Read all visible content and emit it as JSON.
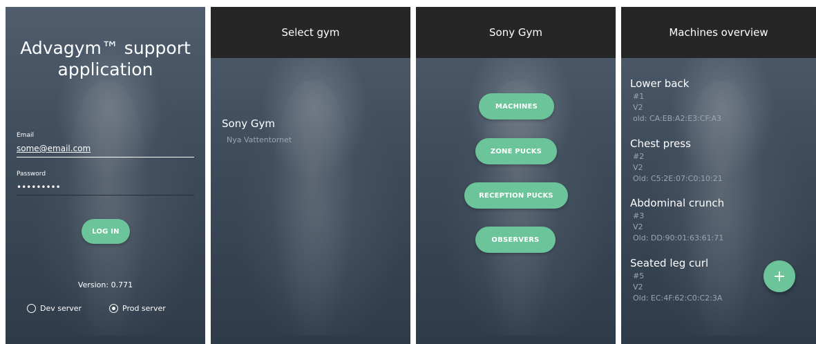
{
  "login": {
    "app_title": "Advagym™ support application",
    "email_label": "Email",
    "email_value": "some@email.com",
    "password_label": "Password",
    "password_value": "•••••••••",
    "login_button": "LOG IN",
    "version": "Version: 0.771",
    "server_options": [
      {
        "label": "Dev server",
        "selected": false
      },
      {
        "label": "Prod server",
        "selected": true
      }
    ]
  },
  "select_gym": {
    "title": "Select gym",
    "gyms": [
      {
        "name": "Sony Gym",
        "location": "Nya Vattentornet"
      }
    ]
  },
  "gym_menu": {
    "title": "Sony Gym",
    "buttons": [
      "MACHINES",
      "ZONE PUCKS",
      "RECEPTION PUCKS",
      "OBSERVERS"
    ]
  },
  "machines": {
    "title": "Machines overview",
    "items": [
      {
        "name": "Lower back",
        "number": "#1",
        "version": "V2",
        "old": "old: CA:EB:A2:E3:CF:A3"
      },
      {
        "name": "Chest press",
        "number": "#2",
        "version": "V2",
        "old": "Old:  C5:2E:07:C0:10:21"
      },
      {
        "name": "Abdominal crunch",
        "number": "#3",
        "version": "V2",
        "old": "Old: DD:90:01:63:61:71"
      },
      {
        "name": "Seated leg curl",
        "number": "#5",
        "version": "V2",
        "old": "Old: EC:4F:62:C0:C2:3A"
      }
    ],
    "fab_label": "+"
  },
  "colors": {
    "accent": "#6cc49b",
    "appbar": "#262626",
    "background": "#3e4b5a"
  }
}
